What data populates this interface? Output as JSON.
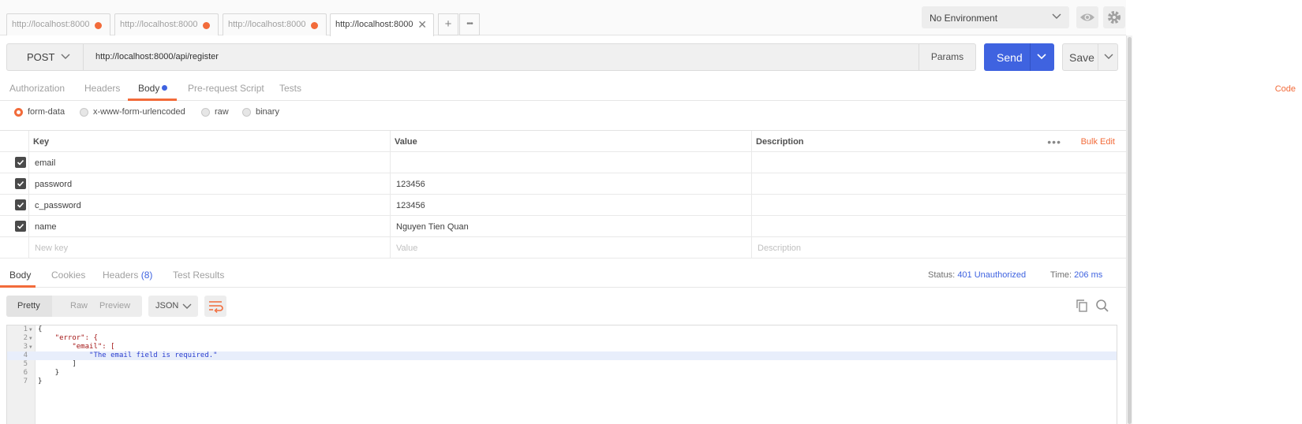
{
  "tabs": [
    {
      "label": "http://localhost:8000",
      "unsaved": true,
      "active": false
    },
    {
      "label": "http://localhost:8000",
      "unsaved": true,
      "active": false
    },
    {
      "label": "http://localhost:8000",
      "unsaved": true,
      "active": false
    },
    {
      "label": "http://localhost:8000",
      "unsaved": false,
      "active": true
    }
  ],
  "tab_actions": {
    "new": "+",
    "more": "•••"
  },
  "environment": {
    "selected": "No Environment"
  },
  "request": {
    "method": "POST",
    "url": "http://localhost:8000/api/register",
    "params_label": "Params",
    "send_label": "Send",
    "save_label": "Save"
  },
  "request_tabs": [
    {
      "label": "Authorization",
      "active": false
    },
    {
      "label": "Headers",
      "active": false
    },
    {
      "label": "Body",
      "active": true,
      "modified": true
    },
    {
      "label": "Pre-request Script",
      "active": false
    },
    {
      "label": "Tests",
      "active": false
    }
  ],
  "code_link": "Code",
  "body_types": [
    {
      "label": "form-data",
      "selected": true
    },
    {
      "label": "x-www-form-urlencoded",
      "selected": false
    },
    {
      "label": "raw",
      "selected": false
    },
    {
      "label": "binary",
      "selected": false
    }
  ],
  "params_table": {
    "headers": {
      "key": "Key",
      "value": "Value",
      "description": "Description"
    },
    "bulk_edit": "Bulk Edit",
    "more": "•••",
    "rows": [
      {
        "checked": true,
        "key": "email",
        "value": "",
        "description": ""
      },
      {
        "checked": true,
        "key": "password",
        "value": "123456",
        "description": ""
      },
      {
        "checked": true,
        "key": "c_password",
        "value": "123456",
        "description": ""
      },
      {
        "checked": true,
        "key": "name",
        "value": "Nguyen Tien Quan",
        "description": ""
      }
    ],
    "placeholders": {
      "key": "New key",
      "value": "Value",
      "description": "Description"
    }
  },
  "response_tabs": [
    {
      "label": "Body",
      "active": true
    },
    {
      "label": "Cookies",
      "active": false
    },
    {
      "label": "Headers",
      "count": "(8)",
      "active": false
    },
    {
      "label": "Test Results",
      "active": false
    }
  ],
  "response_status": {
    "status_label": "Status:",
    "status_value": "401 Unauthorized",
    "time_label": "Time:",
    "time_value": "206 ms"
  },
  "viewer": {
    "modes": [
      "Pretty",
      "Raw",
      "Preview"
    ],
    "selected_mode": "Pretty",
    "format": "JSON"
  },
  "code_lines": [
    {
      "n": "1",
      "fold": true,
      "text": "{"
    },
    {
      "n": "2",
      "fold": true,
      "text": "    \"error\": {"
    },
    {
      "n": "3",
      "fold": true,
      "text": "        \"email\": ["
    },
    {
      "n": "4",
      "fold": false,
      "text": "            \"The email field is required.\""
    },
    {
      "n": "5",
      "fold": false,
      "text": "        ]"
    },
    {
      "n": "6",
      "fold": false,
      "text": "    }"
    },
    {
      "n": "7",
      "fold": false,
      "text": "}"
    }
  ],
  "colors": {
    "accent": "#f26b3a",
    "primary": "#3f63e0"
  }
}
